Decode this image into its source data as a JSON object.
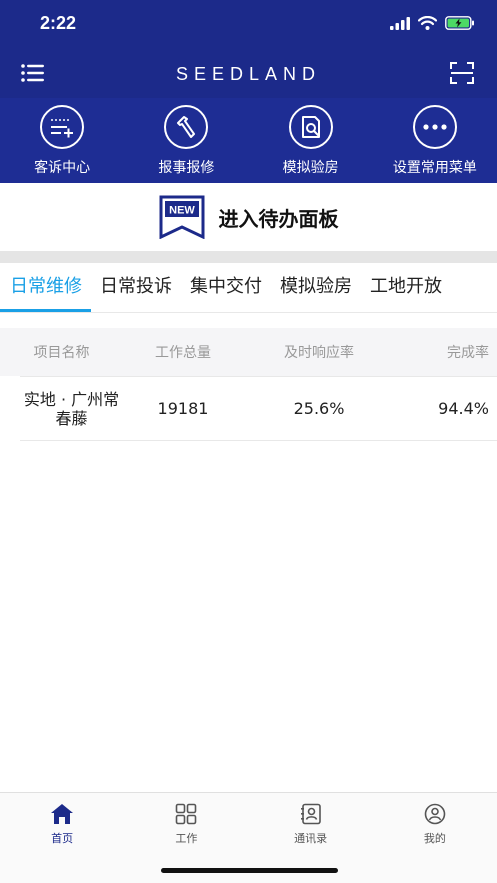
{
  "status_bar": {
    "time": "2:22"
  },
  "brand": "SEEDLAND",
  "quick_actions": [
    {
      "label": "客诉中心",
      "icon": "complaint-icon"
    },
    {
      "label": "报事报修",
      "icon": "hammer-icon"
    },
    {
      "label": "模拟验房",
      "icon": "inspection-icon"
    },
    {
      "label": "设置常用菜单",
      "icon": "more-icon"
    }
  ],
  "todo_banner": {
    "badge": "NEW",
    "text": "进入待办面板"
  },
  "tabs": [
    {
      "label": "日常维修",
      "active": true
    },
    {
      "label": "日常投诉",
      "active": false
    },
    {
      "label": "集中交付",
      "active": false
    },
    {
      "label": "模拟验房",
      "active": false
    },
    {
      "label": "工地开放",
      "active": false
    }
  ],
  "table": {
    "headers": [
      "项目名称",
      "工作总量",
      "及时响应率",
      "完成率"
    ],
    "rows": [
      {
        "project": "实地 · 广州常春藤",
        "total": "19181",
        "response_rate": "25.6%",
        "completion_rate": "94.4%"
      }
    ]
  },
  "tabbar": [
    {
      "label": "首页",
      "icon": "home-icon",
      "active": true
    },
    {
      "label": "工作",
      "icon": "grid-icon",
      "active": false
    },
    {
      "label": "通讯录",
      "icon": "contacts-icon",
      "active": false
    },
    {
      "label": "我的",
      "icon": "profile-icon",
      "active": false
    }
  ],
  "colors": {
    "header": "#1c2a8a",
    "accent": "#1aa0e6",
    "battery": "#4cd964"
  }
}
